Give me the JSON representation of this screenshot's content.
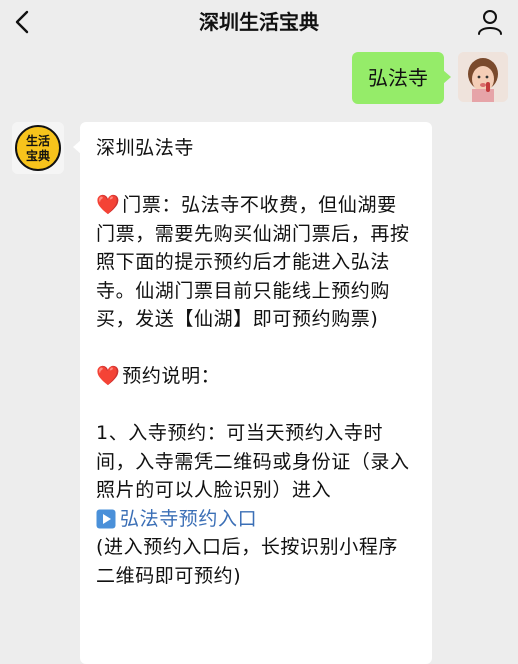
{
  "header": {
    "title": "深圳生活宝典"
  },
  "outgoing": {
    "text": "弘法寺"
  },
  "account_avatar": {
    "line1": "生活",
    "line2": "宝典"
  },
  "incoming": {
    "heading": "深圳弘法寺",
    "ticket_label": "门票：",
    "ticket_text": "弘法寺不收费，但仙湖要门票，需要先购买仙湖门票后，再按照下面的提示预约后才能进入弘法寺。仙湖门票目前只能线上预约购买，发送【仙湖】即可预约购票)",
    "reservation_label": "预约说明：",
    "item1_text": "1、入寺预约：可当天预约入寺时间，入寺需凭二维码或身份证（录入照片的可以人脸识别）进入",
    "link_text": "弘法寺预约入口",
    "note_text": "(进入预约入口后，长按识别小程序二维码即可预约)"
  },
  "icons": {
    "back": "chevron-left-icon",
    "profile": "person-icon",
    "heart": "heart-icon",
    "play": "play-icon"
  },
  "colors": {
    "background": "#ededed",
    "outgoing_bubble": "#95ec69",
    "incoming_bubble": "#ffffff",
    "link": "#3b6fb6",
    "heart": "#e0242d"
  }
}
